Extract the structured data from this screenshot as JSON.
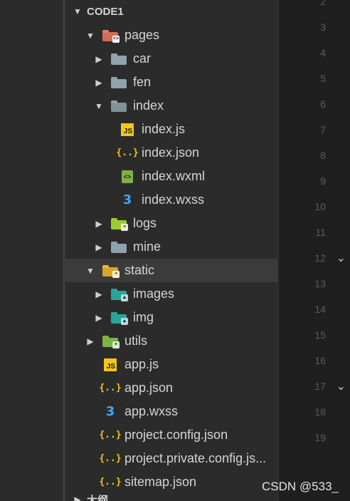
{
  "explorer": {
    "workspace_title": "CODE1",
    "outline_title": "大纲",
    "items": [
      {
        "label": "pages",
        "depth": 1,
        "type": "folder",
        "expanded": true,
        "caret": "down",
        "icon": "pages-folder-icon",
        "color": "#ef7b5a"
      },
      {
        "label": "car",
        "depth": 2,
        "type": "folder",
        "expanded": false,
        "caret": "right",
        "icon": "folder-icon",
        "color": "#8fa3ad"
      },
      {
        "label": "fen",
        "depth": 2,
        "type": "folder",
        "expanded": false,
        "caret": "right",
        "icon": "folder-icon",
        "color": "#8fa3ad"
      },
      {
        "label": "index",
        "depth": 2,
        "type": "folder",
        "expanded": true,
        "caret": "down",
        "icon": "folder-open-icon",
        "color": "#8fa3ad"
      },
      {
        "label": "index.js",
        "depth": 3,
        "type": "file",
        "icon": "js-file-icon"
      },
      {
        "label": "index.json",
        "depth": 3,
        "type": "file",
        "icon": "json-file-icon"
      },
      {
        "label": "index.wxml",
        "depth": 3,
        "type": "file",
        "icon": "wxml-file-icon"
      },
      {
        "label": "index.wxss",
        "depth": 3,
        "type": "file",
        "icon": "wxss-file-icon"
      },
      {
        "label": "logs",
        "depth": 2,
        "type": "folder",
        "expanded": false,
        "caret": "right",
        "icon": "logs-folder-icon",
        "color": "#9ccc2f"
      },
      {
        "label": "mine",
        "depth": 2,
        "type": "folder",
        "expanded": false,
        "caret": "right",
        "icon": "folder-icon",
        "color": "#8fa3ad"
      },
      {
        "label": "static",
        "depth": 1,
        "type": "folder",
        "expanded": true,
        "caret": "down",
        "icon": "static-folder-icon",
        "color": "#f5b82e",
        "selected": true
      },
      {
        "label": "images",
        "depth": 2,
        "type": "folder",
        "expanded": false,
        "caret": "right",
        "icon": "images-folder-icon",
        "color": "#26a69a"
      },
      {
        "label": "img",
        "depth": 2,
        "type": "folder",
        "expanded": false,
        "caret": "right",
        "icon": "images-folder-icon",
        "color": "#26a69a"
      },
      {
        "label": "utils",
        "depth": 1,
        "type": "folder",
        "expanded": false,
        "caret": "right",
        "icon": "utils-folder-icon",
        "color": "#7cb342"
      },
      {
        "label": "app.js",
        "depth": 1,
        "type": "file",
        "icon": "js-file-icon"
      },
      {
        "label": "app.json",
        "depth": 1,
        "type": "file",
        "icon": "json-file-icon"
      },
      {
        "label": "app.wxss",
        "depth": 1,
        "type": "file",
        "icon": "wxss-file-icon"
      },
      {
        "label": "project.config.json",
        "depth": 1,
        "type": "file",
        "icon": "json-file-icon"
      },
      {
        "label": "project.private.config.js...",
        "depth": 1,
        "type": "file",
        "icon": "json-file-icon"
      },
      {
        "label": "sitemap.json",
        "depth": 1,
        "type": "file",
        "icon": "json-file-icon"
      }
    ]
  },
  "editor": {
    "line_numbers": [
      "2",
      "3",
      "4",
      "5",
      "6",
      "7",
      "8",
      "9",
      "10",
      "11",
      "12",
      "13",
      "14",
      "15",
      "16",
      "17",
      "18",
      "19"
    ],
    "fold_marker_lines": [
      "12",
      "17"
    ]
  },
  "watermark": "CSDN @533_"
}
